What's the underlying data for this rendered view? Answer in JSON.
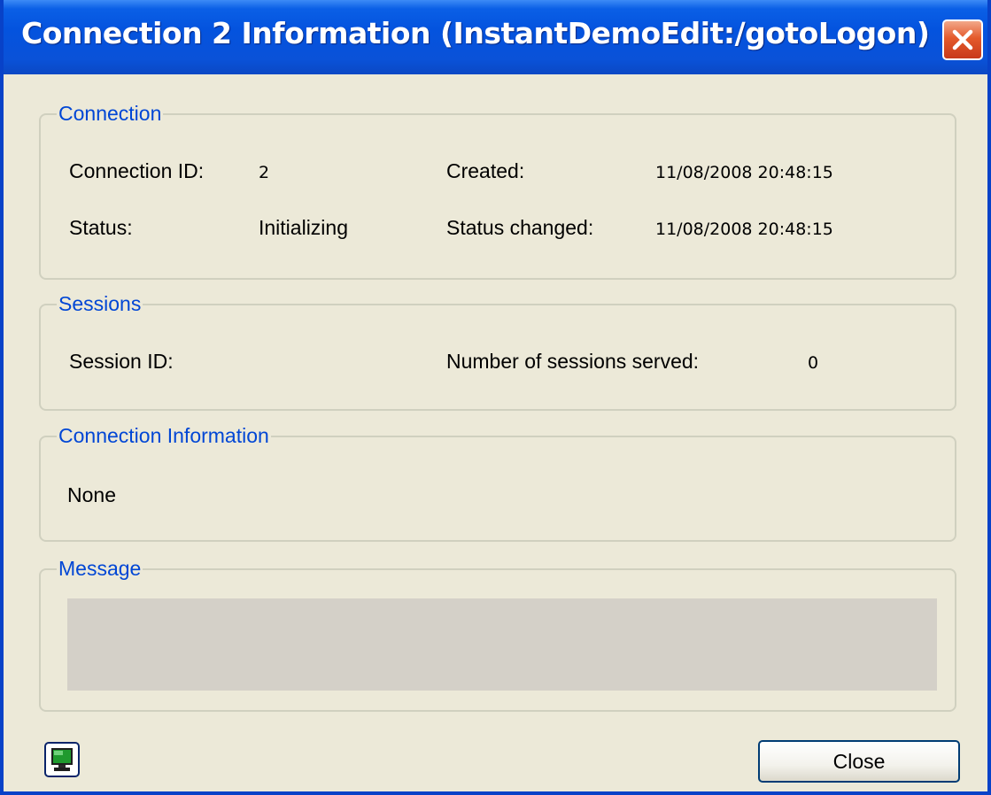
{
  "window": {
    "title": "Connection 2 Information (InstantDemoEdit:/gotoLogon)"
  },
  "connection": {
    "group_title": "Connection",
    "connection_id_label": "Connection ID:",
    "connection_id_value": "2",
    "created_label": "Created:",
    "created_value": "11/08/2008 20:48:15",
    "status_label": "Status:",
    "status_value": "Initializing",
    "status_changed_label": "Status changed:",
    "status_changed_value": "11/08/2008 20:48:15"
  },
  "sessions": {
    "group_title": "Sessions",
    "session_id_label": "Session ID:",
    "session_id_value": "",
    "served_label": "Number of sessions served:",
    "served_value": "0"
  },
  "connection_information": {
    "group_title": "Connection Information",
    "value": "None"
  },
  "message": {
    "group_title": "Message",
    "value": ""
  },
  "footer": {
    "close_label": "Close",
    "monitor_icon": "monitor-icon"
  },
  "colors": {
    "titlebar": "#0453de",
    "group_title": "#0046d5",
    "window_bg": "#ece9d8",
    "close_x": "#e45a2c"
  }
}
